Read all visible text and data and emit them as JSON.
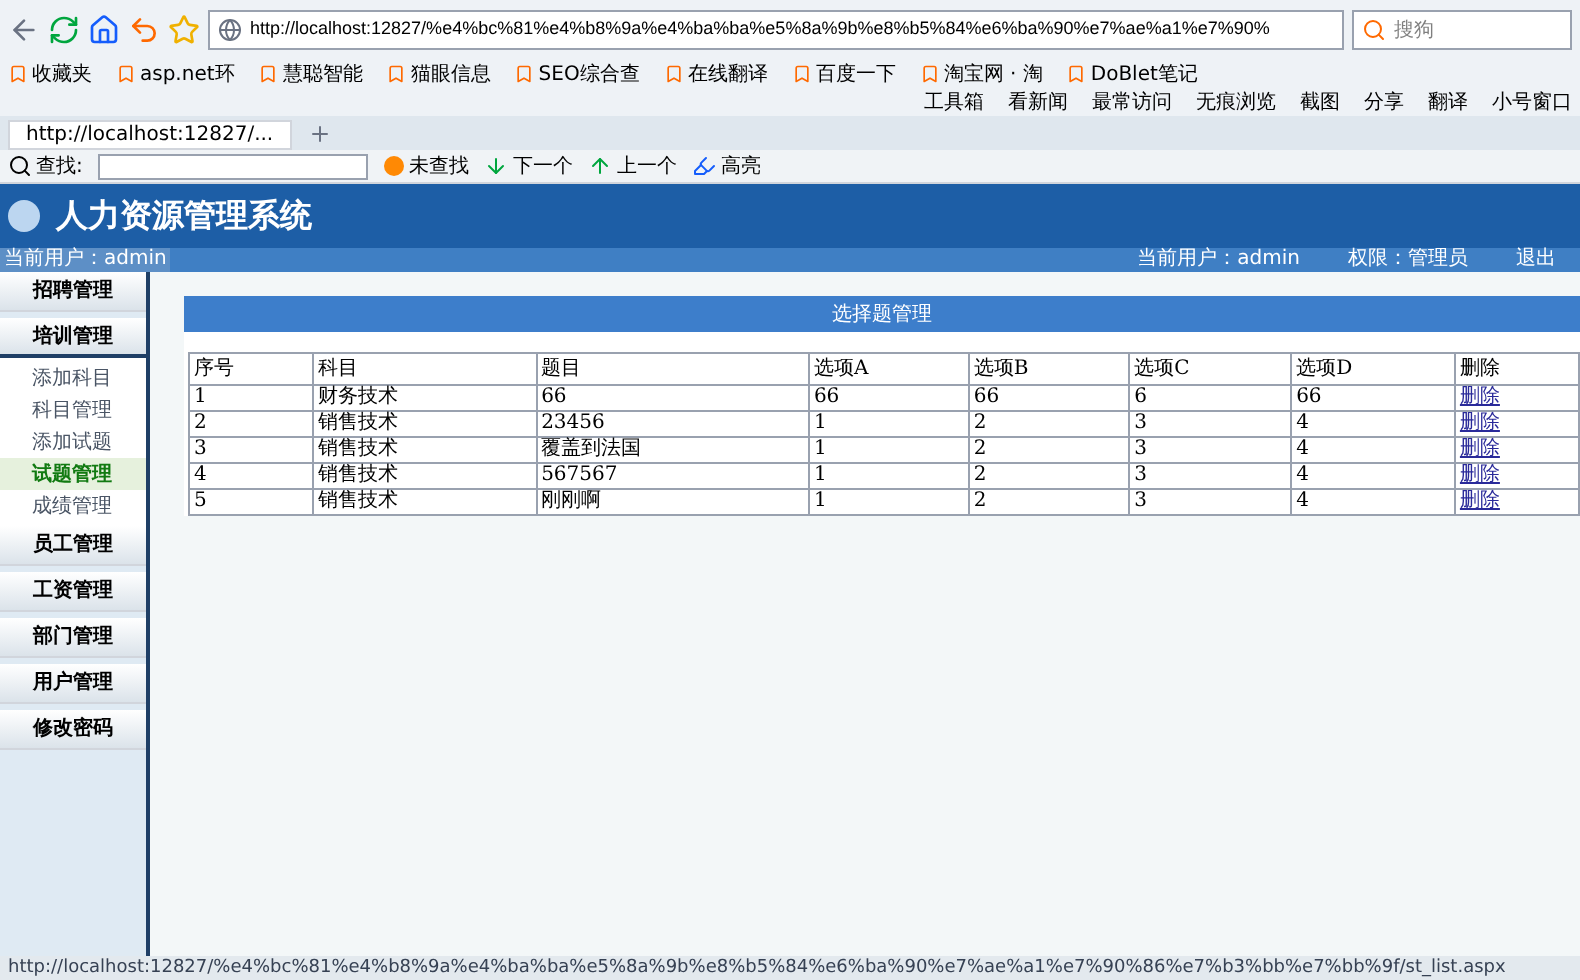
{
  "browser": {
    "address": "http://localhost:12827/%e4%bc%81%e4%b8%9a%e4%ba%ba%e5%8a%9b%e8%b5%84%e6%ba%90%e7%ae%a1%e7%90%",
    "search_placeholder": "搜狗",
    "bookmarks": [
      "收藏夹",
      "asp.net环",
      "慧聪智能",
      "猫眼信息",
      "SEO综合查",
      "在线翻译",
      "百度一下",
      "淘宝网 · 淘",
      "DoBlet笔记"
    ],
    "tools": [
      "工具箱",
      "看新闻",
      "最常访问",
      "无痕浏览",
      "截图",
      "分享",
      "翻译",
      "小号窗口"
    ],
    "tab": "http://localhost:12827/...",
    "find": {
      "label": "查找:",
      "buttons": [
        "未查找",
        "下一个",
        "上一个",
        "高亮"
      ]
    }
  },
  "app": {
    "title": "人力资源管理系统",
    "user_info": [
      "当前用户：admin",
      "权限：管理员",
      "退出"
    ],
    "sidebar_user": "当前用户：admin",
    "menu": [
      {
        "label": "招聘管理"
      },
      {
        "label": "培训管理",
        "expanded": true,
        "children": [
          {
            "label": "添加科目",
            "selected": false
          },
          {
            "label": "科目管理",
            "selected": false
          },
          {
            "label": "添加试题",
            "selected": false
          },
          {
            "label": "试题管理",
            "selected": true
          },
          {
            "label": "成绩管理",
            "selected": false
          }
        ]
      },
      {
        "label": "员工管理"
      },
      {
        "label": "工资管理"
      },
      {
        "label": "部门管理"
      },
      {
        "label": "用户管理"
      },
      {
        "label": "修改密码"
      }
    ]
  },
  "panel": {
    "title": "选择题管理",
    "columns": [
      "序号",
      "科目",
      "题目",
      "选项A",
      "选项B",
      "选项C",
      "选项D",
      "删除"
    ],
    "rows": [
      [
        "1",
        "财务技术",
        "66",
        "66",
        "66",
        "6",
        "66",
        "删除"
      ],
      [
        "2",
        "销售技术",
        "23456",
        "1",
        "2",
        "3",
        "4",
        "删除"
      ],
      [
        "3",
        "销售技术",
        "覆盖到法国",
        "1",
        "2",
        "3",
        "4",
        "删除"
      ],
      [
        "4",
        "销售技术",
        "567567",
        "1",
        "2",
        "3",
        "4",
        "删除"
      ],
      [
        "5",
        "销售技术",
        "刚刚啊",
        "1",
        "2",
        "3",
        "4",
        "删除"
      ]
    ]
  },
  "status_bar": "http://localhost:12827/%e4%bc%81%e4%b8%9a%e4%ba%ba%e5%8a%9b%e8%b5%84%e6%ba%90%e7%ae%a1%e7%90%86%e7%b3%bb%e7%bb%9f/st_list.aspx"
}
